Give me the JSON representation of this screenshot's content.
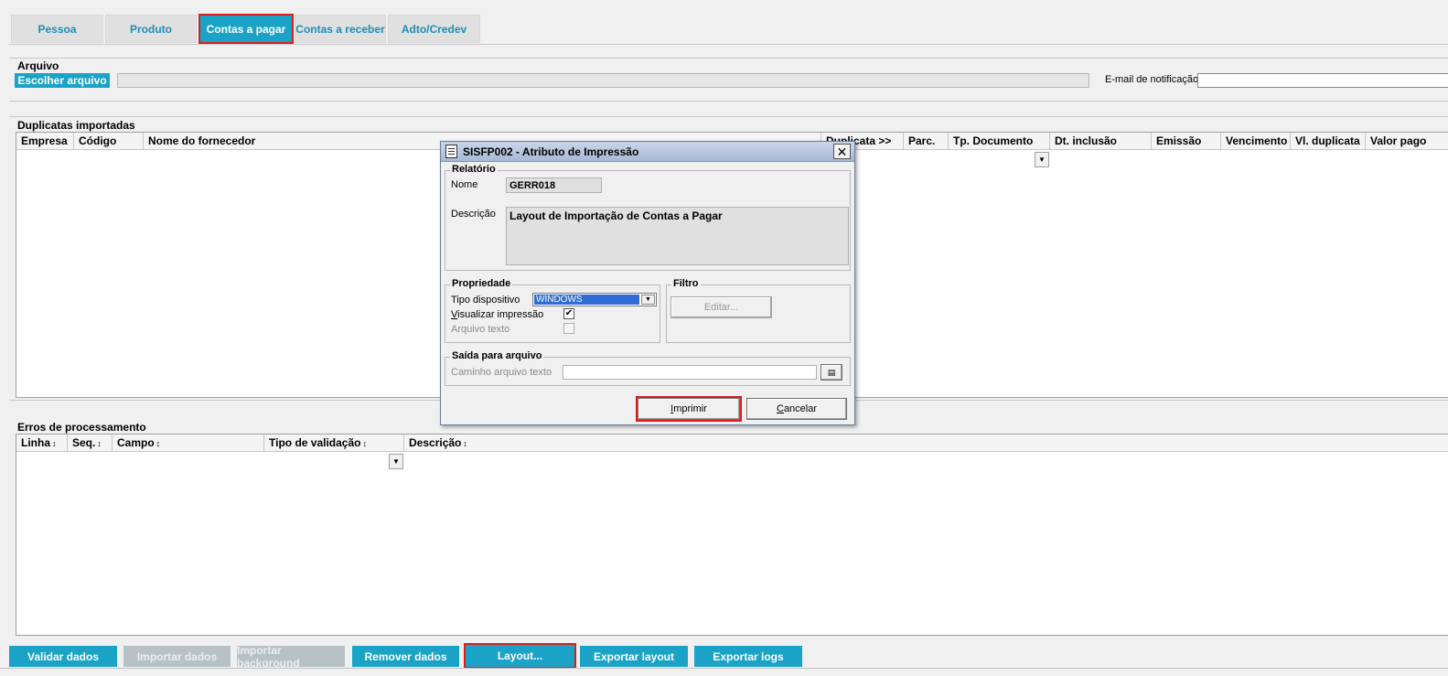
{
  "tabs": [
    {
      "label": "Pessoa",
      "active": false
    },
    {
      "label": "Produto",
      "active": false
    },
    {
      "label": "Contas a pagar",
      "active": true
    },
    {
      "label": "Contas a receber",
      "active": false
    },
    {
      "label": "Adto/Credev",
      "active": false
    }
  ],
  "arquivo": {
    "title": "Arquivo",
    "choose_button": "Escolher arquivo",
    "email_label": "E-mail de notificação",
    "email_value": ""
  },
  "duplicatas": {
    "title": "Duplicatas importadas",
    "columns": [
      "Empresa",
      "Código",
      "Nome do fornecedor",
      "Duplicata >>",
      "Parc.",
      "Tp. Documento",
      "Dt. inclusão",
      "Emissão",
      "Vencimento",
      "Vl. duplicata",
      "Valor pago"
    ]
  },
  "erros": {
    "title": "Erros de processamento",
    "columns": [
      "Linha",
      "Seq.",
      "Campo",
      "Tipo de validação",
      "Descrição"
    ],
    "sort_glyph": "↕"
  },
  "bottom_buttons": [
    {
      "label": "Validar dados",
      "enabled": true
    },
    {
      "label": "Importar dados",
      "enabled": false
    },
    {
      "label": "Importar background",
      "enabled": false
    },
    {
      "label": "Remover dados",
      "enabled": true
    },
    {
      "label": "Layout...",
      "enabled": true,
      "highlighted": true
    },
    {
      "label": "Exportar layout",
      "enabled": true
    },
    {
      "label": "Exportar logs",
      "enabled": true
    }
  ],
  "dialog": {
    "title": "SISFP002 - Atributo de Impressão",
    "close_glyph": "✕",
    "relatorio": {
      "legend": "Relatório",
      "nome_label": "Nome",
      "nome_value": "GERR018",
      "descricao_label": "Descrição",
      "descricao_value": "Layout de Importação de Contas a Pagar"
    },
    "propriedade": {
      "legend": "Propriedade",
      "tipo_label": "Tipo dispositivo",
      "tipo_value": "WINDOWS",
      "visualizar_label_first": "V",
      "visualizar_label_rest": "isualizar impressão",
      "visualizar_checked": "✔",
      "arquivo_texto_label": "Arquivo texto"
    },
    "filtro": {
      "legend": "Filtro",
      "editar_label": "Editar..."
    },
    "saida": {
      "legend": "Saída para arquivo",
      "caminho_label": "Caminho arquivo texto",
      "caminho_value": ""
    },
    "imprimir_first": "I",
    "imprimir_rest": "mprimir",
    "cancelar_first": "C",
    "cancelar_rest": "ancelar"
  },
  "colors": {
    "accent": "#1aa3c6",
    "highlight_outline": "#d62020",
    "tab_text": "#1a8fb5"
  }
}
